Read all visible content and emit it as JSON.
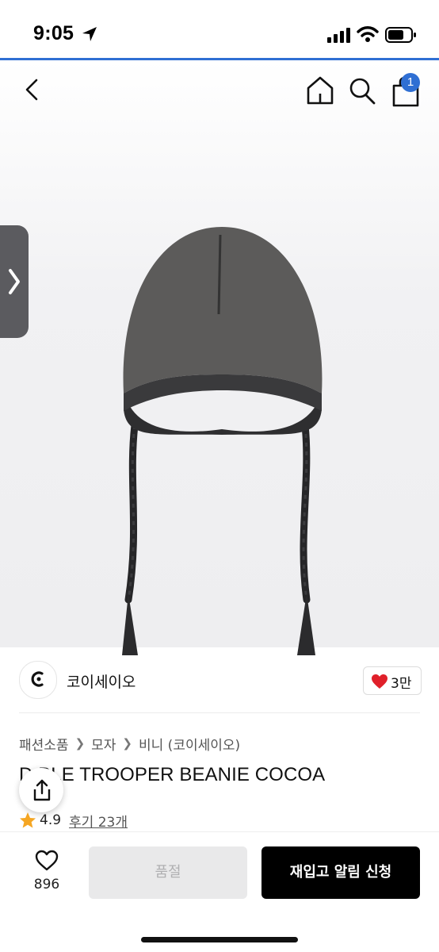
{
  "status_bar": {
    "time": "9:05"
  },
  "header": {
    "cart_badge": "1",
    "icons": [
      "back-icon",
      "home-icon",
      "search-icon",
      "cart-icon"
    ]
  },
  "brand": {
    "name": "코이세이오",
    "like_count": "3만"
  },
  "breadcrumb": [
    "패션소품",
    "모자",
    "비니 (코이세이오)"
  ],
  "product": {
    "title": "D   BLE TROOPER BEANIE COCOA",
    "rating": "4.9",
    "reviews": "후기 23개"
  },
  "bottom_bar": {
    "wish_count": "896",
    "soldout_label": "품절",
    "restock_label": "재입고 알림 신청"
  },
  "colors": {
    "accent": "#2f6fd3",
    "heart": "#e0202a",
    "star": "#f5a623",
    "primary_button": "#000000",
    "disabled_button": "#e9e9ea"
  }
}
